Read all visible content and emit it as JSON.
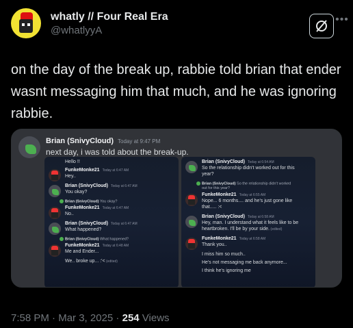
{
  "author": {
    "display_name": "whatly // Four Real Era",
    "handle": "@whatlyyA"
  },
  "tweet": {
    "text": "on the day of the break up, rabbie told brian that ender wasnt messaging him that much, and he was ignoring rabbie."
  },
  "media": {
    "outer_message": {
      "author": "Brian (SnivyCloud)",
      "time": "Today at 9:47 PM",
      "text": "next day, i was told about the break-up."
    },
    "left_chat": [
      {
        "kind": "text",
        "text": "Hello !!"
      },
      {
        "kind": "msg",
        "author": "FunkeMonke21",
        "time": "Today at 6:47 AM",
        "text": "Hey.."
      },
      {
        "kind": "msg",
        "author": "Brian (SnivyCloud)",
        "time": "Today at 6:47 AM",
        "text": "You okay?"
      },
      {
        "kind": "reply",
        "author": "Brian (SnivyCloud)",
        "text": "You okay?"
      },
      {
        "kind": "msg",
        "author": "FunkeMonke21",
        "time": "Today at 6:47 AM",
        "text": "No.."
      },
      {
        "kind": "msg",
        "author": "Brian (SnivyCloud)",
        "time": "Today at 6:47 AM",
        "text": "What happened?"
      },
      {
        "kind": "reply",
        "author": "Brian (SnivyCloud)",
        "text": "What happened?"
      },
      {
        "kind": "msg",
        "author": "FunkeMonke21",
        "time": "Today at 6:48 AM",
        "text": "Me and Ender..."
      },
      {
        "kind": "text",
        "text": "We.. broke up... :'<",
        "suffix": "(edited)"
      }
    ],
    "right_chat": [
      {
        "kind": "msg",
        "author": "Brian (SnivyCloud)",
        "time": "Today at 6:54 AM",
        "text": "So the relationship didn't worked out for this",
        "text2": "year?"
      },
      {
        "kind": "reply",
        "author": "Brian (SnivyCloud)",
        "text": "So the relationship didn't worked",
        "text2": "out for this year?"
      },
      {
        "kind": "msg",
        "author": "FunkeMonke21",
        "time": "Today at 6:55 AM",
        "text": "Nope... 6 months.... and he's just gone like",
        "text2": "that..... :<"
      },
      {
        "kind": "msg",
        "author": "Brian (SnivyCloud)",
        "time": "Today at 6:58 AM",
        "text": "Hey, man. I understand what it feels like to be",
        "text2": "heartbroken. I'll be by your side.",
        "suffix": "(edited)"
      },
      {
        "kind": "msg",
        "author": "FunkeMonke21",
        "time": "Today at 6:58 AM",
        "text": "Thank you.."
      },
      {
        "kind": "text",
        "text": "I miss him so much.."
      },
      {
        "kind": "text",
        "text": "He's not messaging me back anymore..."
      },
      {
        "kind": "text",
        "text": "I think he's ignoring me"
      }
    ]
  },
  "meta": {
    "time": "7:58 PM",
    "sep1": " · ",
    "date": "Mar 3, 2025",
    "sep2": " · ",
    "views_count": "254",
    "views_label": " Views"
  },
  "icons": {
    "grok": "grok-icon",
    "more": "more-icon"
  }
}
